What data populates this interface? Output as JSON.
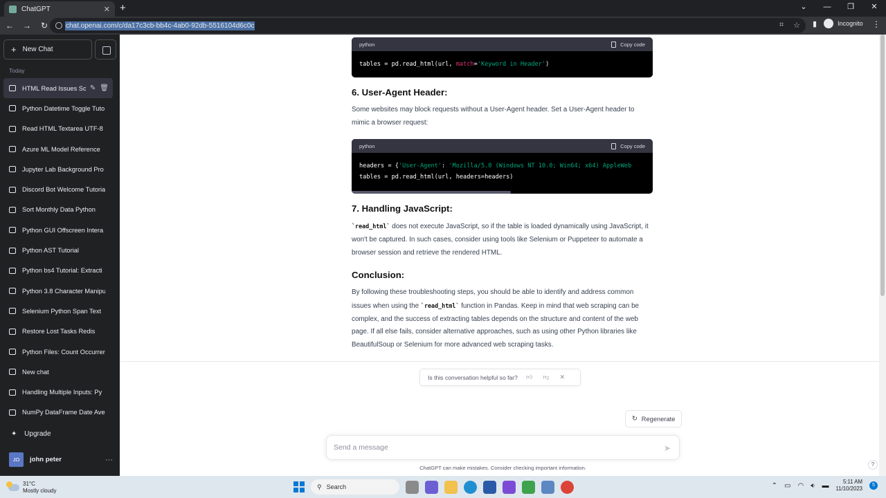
{
  "browser": {
    "tab_title": "ChatGPT",
    "url": "chat.openai.com/c/da17c3cb-bb4c-4ab0-92db-5516104d6c0c",
    "profile_label": "Incognito"
  },
  "sidebar": {
    "new_chat_label": "New Chat",
    "section_label": "Today",
    "items": [
      {
        "label": "HTML Read Issues Sol",
        "active": true
      },
      {
        "label": "Python Datetime Toggle Tuto"
      },
      {
        "label": "Read HTML Textarea UTF-8"
      },
      {
        "label": "Azure ML Model Reference"
      },
      {
        "label": "Jupyter Lab Background Pro"
      },
      {
        "label": "Discord Bot Welcome Tutoria"
      },
      {
        "label": "Sort Monthly Data Python"
      },
      {
        "label": "Python GUI Offscreen Intera"
      },
      {
        "label": "Python AST Tutorial"
      },
      {
        "label": "Python bs4 Tutorial: Extracti"
      },
      {
        "label": "Python 3.8 Character Manipu"
      },
      {
        "label": "Selenium Python Span Text"
      },
      {
        "label": "Restore Lost Tasks Redis"
      },
      {
        "label": "Python Files: Count Occurren"
      },
      {
        "label": "New chat"
      },
      {
        "label": "Handling Multiple Inputs: Py"
      },
      {
        "label": "NumPy DataFrame Date Ave"
      }
    ],
    "upgrade_label": "Upgrade",
    "user": {
      "initials": "JO",
      "name": "john peter"
    }
  },
  "main": {
    "code1": {
      "lang": "python",
      "copy_label": "Copy code",
      "prefix": "tables = pd.read_html(url, ",
      "kw": "match",
      "eq": "=",
      "str": "'Keyword in Header'",
      "suffix": ")"
    },
    "h6": "6. User-Agent Header:",
    "p6": "Some websites may block requests without a User-Agent header. Set a User-Agent header to mimic a browser request:",
    "code2": {
      "lang": "python",
      "copy_label": "Copy code",
      "l1_prefix": "headers = {",
      "l1_key": "'User-Agent'",
      "l1_colon": ": ",
      "l1_val": "'Mozilla/5.0 (Windows NT 10.0; Win64; x64) AppleWeb",
      "l2": "tables = pd.read_html(url, headers=headers)"
    },
    "h7": "7. Handling JavaScript:",
    "p7_code": "`read_html`",
    "p7": " does not execute JavaScript, so if the table is loaded dynamically using JavaScript, it won't be captured. In such cases, consider using tools like Selenium or Puppeteer to automate a browser session and retrieve the rendered HTML.",
    "hc": "Conclusion:",
    "pc_a": "By following these troubleshooting steps, you should be able to identify and address common issues when using the ",
    "pc_code": "`read_html`",
    "pc_b": " function in Pandas. Keep in mind that web scraping can be complex, and the success of extracting tables depends on the structure and content of the web page. If all else fails, consider alternative approaches, such as using other Python libraries like BeautifulSoup or Selenium for more advanced web scraping tasks.",
    "helpful_q": "Is this conversation helpful so far?",
    "regenerate_label": "Regenerate",
    "input_placeholder": "Send a message",
    "disclaimer": "ChatGPT can make mistakes. Consider checking important information.",
    "help": "?"
  },
  "taskbar": {
    "temp": "31°C",
    "weather": "Mostly cloudy",
    "search_label": "Search",
    "time": "5:11 AM",
    "date": "11/10/2023",
    "notif_count": "5"
  }
}
